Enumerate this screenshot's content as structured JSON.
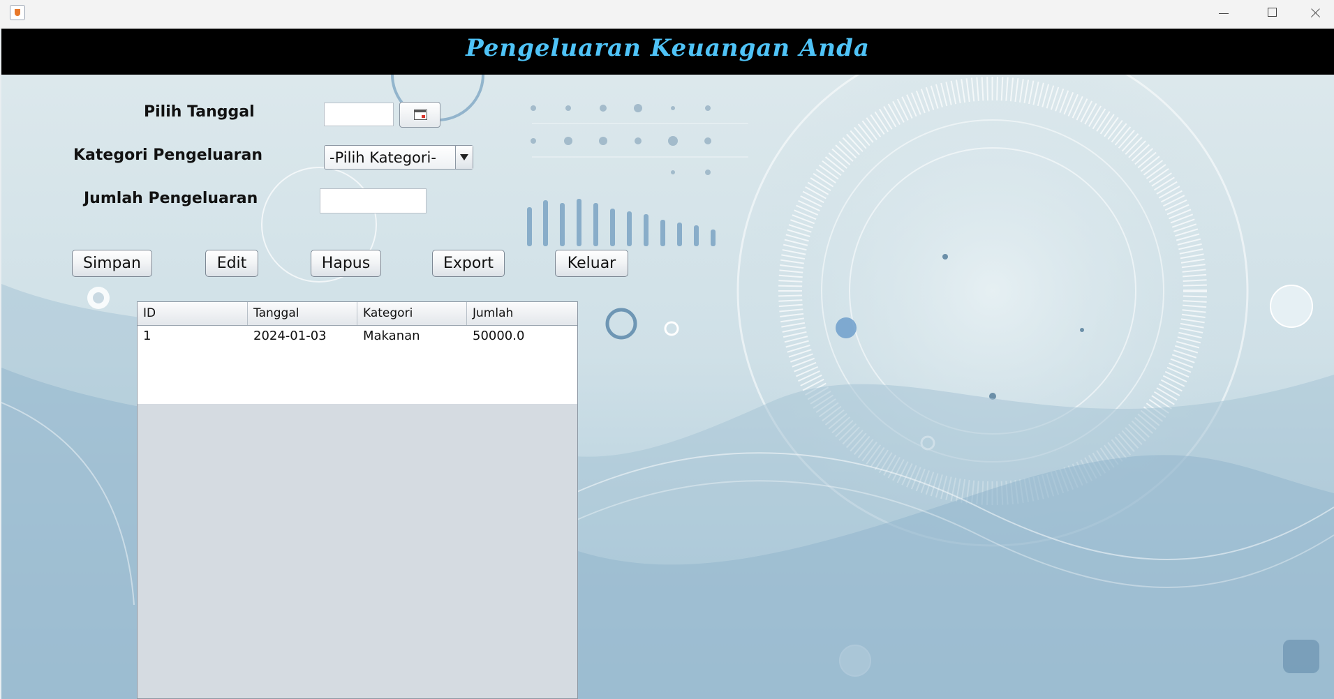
{
  "window": {
    "controls": {
      "minimize": "minimize",
      "maximize": "maximize",
      "close": "close"
    }
  },
  "header": {
    "title": "Pengeluaran Keuangan Anda"
  },
  "form": {
    "date_label": "Pilih Tanggal",
    "date_value": "",
    "category_label": "Kategori Pengeluaran",
    "category_selected": "-Pilih Kategori-",
    "amount_label": "Jumlah Pengeluaran",
    "amount_value": ""
  },
  "buttons": {
    "save": "Simpan",
    "edit": "Edit",
    "delete": "Hapus",
    "export": "Export",
    "exit": "Keluar"
  },
  "table": {
    "columns": [
      "ID",
      "Tanggal",
      "Kategori",
      "Jumlah"
    ],
    "rows": [
      [
        "1",
        "2024-01-03",
        "Makanan",
        "50000.0"
      ]
    ]
  },
  "colors": {
    "header_bg": "#000000",
    "title_text": "#4fc3f7",
    "background": "#cfe0e7"
  },
  "icons": {
    "app": "java-app-icon",
    "calendar": "calendar-icon",
    "dropdown": "chevron-down-icon"
  }
}
